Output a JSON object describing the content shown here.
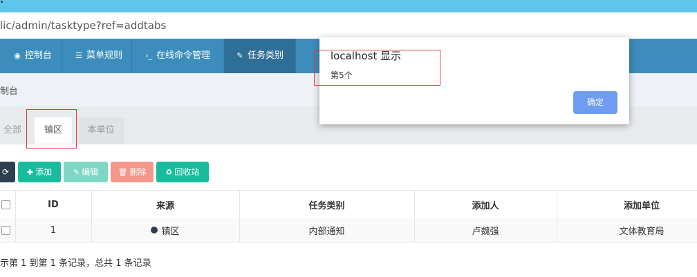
{
  "browser": {
    "url": "lic/admin/tasktype?ref=addtabs"
  },
  "nav": {
    "items": [
      {
        "label": "控制台",
        "icon": "dashboard-icon"
      },
      {
        "label": "菜单规则",
        "icon": "list-icon"
      },
      {
        "label": "在线命令管理",
        "icon": "terminal-icon"
      },
      {
        "label": "任务类别",
        "icon": "edit-icon"
      }
    ]
  },
  "breadcrumb": "制台",
  "tabs": [
    "全部",
    "镇区",
    "本单位"
  ],
  "toolbar": {
    "refresh_icon": "refresh-icon",
    "add": "添加",
    "edit": "编辑",
    "delete": "删除",
    "recycle": "回收站",
    "colors": {
      "add": "#18bc9c",
      "edit": "#7fd6c4",
      "delete": "#f3968c",
      "recycle": "#18bc9c",
      "refresh": "#2c3e50"
    }
  },
  "table": {
    "headers": [
      "ID",
      "来源",
      "任务类别",
      "添加人",
      "添加单位"
    ],
    "rows": [
      {
        "id": "1",
        "source": "镇区",
        "type": "内部通知",
        "creator": "卢魏强",
        "unit": "文体教育局"
      }
    ]
  },
  "footer": "示第 1 到第 1 条记录，总共 1 条记录",
  "dialog": {
    "title": "localhost 显示",
    "message": "第5个",
    "ok": "确定"
  }
}
